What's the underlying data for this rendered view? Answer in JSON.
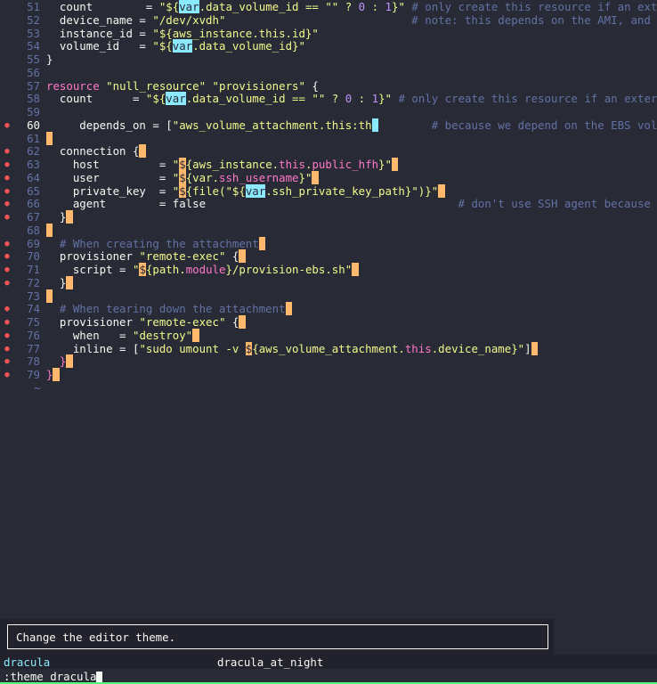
{
  "editor": {
    "lines": [
      {
        "num": "51",
        "diag": "",
        "segs": [
          [
            "attr",
            "  count        = "
          ],
          [
            "str",
            "\"${"
          ],
          [
            "hl",
            "var"
          ],
          [
            "str",
            ".data_volume_id == \"\" ? "
          ],
          [
            "num",
            "0"
          ],
          [
            "str",
            " : "
          ],
          [
            "num",
            "1"
          ],
          [
            "str",
            "}\""
          ],
          [
            "cmt",
            " # only create this resource if an external EBS"
          ]
        ]
      },
      {
        "num": "52",
        "diag": "",
        "segs": [
          [
            "attr",
            "  device_name = "
          ],
          [
            "str",
            "\"/dev/xvdh\""
          ],
          [
            "cmt",
            "                            # note: this depends on the AMI, and can't be"
          ]
        ]
      },
      {
        "num": "53",
        "diag": "",
        "segs": [
          [
            "attr",
            "  instance_id = "
          ],
          [
            "str",
            "\"${aws_instance.this.id}\""
          ]
        ]
      },
      {
        "num": "54",
        "diag": "",
        "segs": [
          [
            "attr",
            "  volume_id   = "
          ],
          [
            "str",
            "\"${"
          ],
          [
            "hl",
            "var"
          ],
          [
            "str",
            ".data_volume_id}\""
          ]
        ]
      },
      {
        "num": "55",
        "diag": "",
        "segs": [
          [
            "attr",
            "}"
          ]
        ]
      },
      {
        "num": "56",
        "diag": "",
        "segs": []
      },
      {
        "num": "57",
        "diag": "",
        "segs": [
          [
            "kw",
            "resource"
          ],
          [
            "attr",
            " "
          ],
          [
            "str",
            "\"null_resource\""
          ],
          [
            "attr",
            " "
          ],
          [
            "str",
            "\"provisioners\""
          ],
          [
            "attr",
            " {"
          ]
        ]
      },
      {
        "num": "58",
        "diag": "",
        "segs": [
          [
            "attr",
            "  count      = "
          ],
          [
            "str",
            "\"${"
          ],
          [
            "hl",
            "var"
          ],
          [
            "str",
            ".data_volume_id == \"\" ? "
          ],
          [
            "num",
            "0"
          ],
          [
            "str",
            " : "
          ],
          [
            "num",
            "1"
          ],
          [
            "str",
            "}\""
          ],
          [
            "cmt",
            " # only create this resource if an external EBS"
          ]
        ]
      },
      {
        "num": "59",
        "diag": "",
        "segs": []
      },
      {
        "num": "60",
        "diag": "●",
        "cur": true,
        "segs": [
          [
            "attr",
            "     depends_on = ["
          ],
          [
            "str",
            "\"aws_volume_attachment.this:th"
          ],
          [
            "cursor",
            " "
          ],
          [
            "cmt",
            "        # because we depend on the EBS volume being"
          ]
        ]
      },
      {
        "num": "61",
        "diag": "",
        "segs": [
          [
            "cursorblock",
            " "
          ]
        ]
      },
      {
        "num": "62",
        "diag": "●",
        "segs": [
          [
            "attr",
            "  connection {"
          ],
          [
            "cursorblock",
            " "
          ]
        ]
      },
      {
        "num": "63",
        "diag": "●",
        "segs": [
          [
            "attr",
            "    host         = "
          ],
          [
            "str",
            "\""
          ],
          [
            "cursorblock",
            "$"
          ],
          [
            "str",
            "{aws_instance."
          ],
          [
            "kw",
            "this"
          ],
          [
            "str",
            "."
          ],
          [
            "kw",
            "public_hfh"
          ],
          [
            "str",
            "}\""
          ],
          [
            "cursorblock",
            " "
          ]
        ]
      },
      {
        "num": "64",
        "diag": "●",
        "segs": [
          [
            "attr",
            "    user         = "
          ],
          [
            "str",
            "\""
          ],
          [
            "cursorblock",
            "$"
          ],
          [
            "str",
            "{var."
          ],
          [
            "kw",
            "ssh_username"
          ],
          [
            "str",
            "}\""
          ],
          [
            "cursorblock",
            " "
          ]
        ]
      },
      {
        "num": "65",
        "diag": "●",
        "segs": [
          [
            "attr",
            "    private_key  = "
          ],
          [
            "str",
            "\""
          ],
          [
            "cursorblock",
            "$"
          ],
          [
            "str",
            "{file(\"${"
          ],
          [
            "hl",
            "var"
          ],
          [
            "str",
            ".ssh_private_key_path}\")}\""
          ],
          [
            "cursorblock",
            " "
          ]
        ]
      },
      {
        "num": "66",
        "diag": "●",
        "segs": [
          [
            "attr",
            "    agent        = "
          ],
          [
            "attr",
            "false"
          ],
          [
            "cmt",
            "                                      # don't use SSH agent because we have the"
          ]
        ]
      },
      {
        "num": "67",
        "diag": "●",
        "segs": [
          [
            "attr",
            "  }"
          ],
          [
            "cursorblock",
            " "
          ]
        ]
      },
      {
        "num": "68",
        "diag": "",
        "segs": [
          [
            "cursorblock",
            " "
          ]
        ]
      },
      {
        "num": "69",
        "diag": "●",
        "segs": [
          [
            "cmt",
            "  # When creating the attachment"
          ],
          [
            "cursorblock",
            " "
          ]
        ]
      },
      {
        "num": "70",
        "diag": "●",
        "segs": [
          [
            "attr",
            "  provisioner "
          ],
          [
            "str",
            "\"remote-exec\""
          ],
          [
            "attr",
            " {"
          ],
          [
            "cursorblock",
            " "
          ]
        ]
      },
      {
        "num": "71",
        "diag": "●",
        "segs": [
          [
            "attr",
            "    script = "
          ],
          [
            "str",
            "\""
          ],
          [
            "cursorblock",
            "$"
          ],
          [
            "str",
            "{path."
          ],
          [
            "kw",
            "module"
          ],
          [
            "str",
            "}/provision-ebs.sh\""
          ],
          [
            "cursorblock",
            " "
          ]
        ]
      },
      {
        "num": "72",
        "diag": "●",
        "segs": [
          [
            "attr",
            "  }"
          ],
          [
            "cursorblock",
            " "
          ]
        ]
      },
      {
        "num": "73",
        "diag": "",
        "segs": [
          [
            "cursorblock",
            " "
          ]
        ]
      },
      {
        "num": "74",
        "diag": "●",
        "segs": [
          [
            "cmt",
            "  # When tearing down the attachment"
          ],
          [
            "cursorblock",
            " "
          ]
        ]
      },
      {
        "num": "75",
        "diag": "●",
        "segs": [
          [
            "attr",
            "  provisioner "
          ],
          [
            "str",
            "\"remote-exec\""
          ],
          [
            "attr",
            " {"
          ],
          [
            "cursorblock",
            " "
          ]
        ]
      },
      {
        "num": "76",
        "diag": "●",
        "segs": [
          [
            "attr",
            "    when   = "
          ],
          [
            "str",
            "\"destroy\""
          ],
          [
            "cursorblock",
            " "
          ]
        ]
      },
      {
        "num": "77",
        "diag": "●",
        "segs": [
          [
            "attr",
            "    inline = ["
          ],
          [
            "str",
            "\"sudo umount -v "
          ],
          [
            "cursorblock",
            "$"
          ],
          [
            "str",
            "{aws_volume_attachment."
          ],
          [
            "kw",
            "this"
          ],
          [
            "str",
            ".device_name}\""
          ],
          [
            "attr",
            "]"
          ],
          [
            "cursorblock",
            " "
          ]
        ]
      },
      {
        "num": "78",
        "diag": "●",
        "segs": [
          [
            "kw",
            "  }"
          ],
          [
            "cursorblock",
            " "
          ]
        ]
      },
      {
        "num": "79",
        "diag": "●",
        "segs": [
          [
            "kw",
            "}"
          ],
          [
            "cursorblock",
            " "
          ]
        ]
      }
    ],
    "tilde": "~"
  },
  "popup": {
    "text": "Change the editor theme."
  },
  "completion": {
    "items": [
      "dracula",
      "dracula_at_night"
    ]
  },
  "cmdline": {
    "text": ":theme dracula"
  }
}
